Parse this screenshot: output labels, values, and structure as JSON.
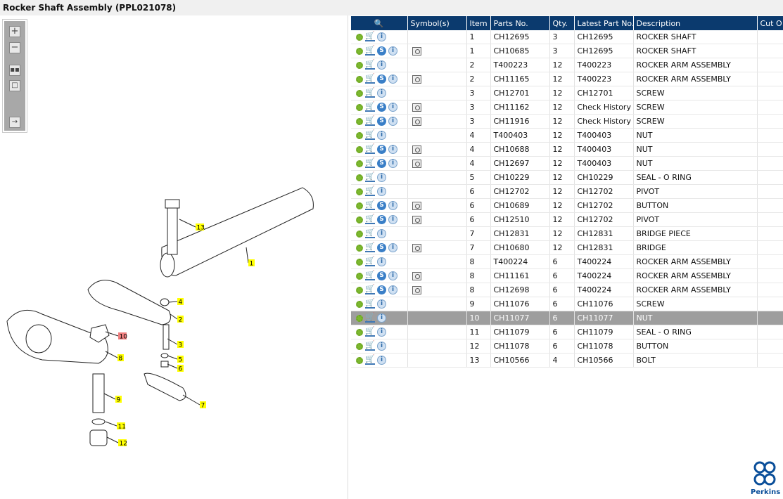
{
  "title": "Rocker Shaft Assembly (PPL021078)",
  "toolbar": [
    {
      "icon": "zoom-in-icon"
    },
    {
      "icon": "zoom-out-icon"
    },
    {
      "icon": "fit-all-icon"
    },
    {
      "icon": "actual-size-icon"
    },
    {
      "icon": "export-list-icon"
    }
  ],
  "diagram": {
    "callouts": [
      "13",
      "1",
      "4",
      "2",
      "10",
      "3",
      "8",
      "5",
      "6",
      "9",
      "7",
      "11",
      "12"
    ],
    "highlighted": "10",
    "highlight_color": "#f08080",
    "callout_color": "#ffff00"
  },
  "table": {
    "header_icon": "search-catalog-icon",
    "columns": [
      "",
      "Symbol(s)",
      "Item",
      "Parts No.",
      "Qty.",
      "Latest Part No.",
      "Description",
      "Cut O"
    ],
    "header_color": "#0b3a6e",
    "selected_color": "#9e9e9e",
    "rows": [
      {
        "item": "1",
        "part": "CH12695",
        "qty": "3",
        "latest": "CH12695",
        "desc": "ROCKER SHAFT",
        "s": false,
        "sym": false
      },
      {
        "item": "1",
        "part": "CH10685",
        "qty": "3",
        "latest": "CH12695",
        "desc": "ROCKER SHAFT",
        "s": true,
        "sym": true
      },
      {
        "item": "2",
        "part": "T400223",
        "qty": "12",
        "latest": "T400223",
        "desc": "ROCKER ARM ASSEMBLY",
        "s": false,
        "sym": false
      },
      {
        "item": "2",
        "part": "CH11165",
        "qty": "12",
        "latest": "T400223",
        "desc": "ROCKER ARM ASSEMBLY",
        "s": true,
        "sym": true
      },
      {
        "item": "3",
        "part": "CH12701",
        "qty": "12",
        "latest": "CH12701",
        "desc": "SCREW",
        "s": false,
        "sym": false
      },
      {
        "item": "3",
        "part": "CH11162",
        "qty": "12",
        "latest": "Check History",
        "desc": "SCREW",
        "s": true,
        "sym": true
      },
      {
        "item": "3",
        "part": "CH11916",
        "qty": "12",
        "latest": "Check History",
        "desc": "SCREW",
        "s": true,
        "sym": true
      },
      {
        "item": "4",
        "part": "T400403",
        "qty": "12",
        "latest": "T400403",
        "desc": "NUT",
        "s": false,
        "sym": false
      },
      {
        "item": "4",
        "part": "CH10688",
        "qty": "12",
        "latest": "T400403",
        "desc": "NUT",
        "s": true,
        "sym": true
      },
      {
        "item": "4",
        "part": "CH12697",
        "qty": "12",
        "latest": "T400403",
        "desc": "NUT",
        "s": true,
        "sym": true
      },
      {
        "item": "5",
        "part": "CH10229",
        "qty": "12",
        "latest": "CH10229",
        "desc": "SEAL - O RING",
        "s": false,
        "sym": false
      },
      {
        "item": "6",
        "part": "CH12702",
        "qty": "12",
        "latest": "CH12702",
        "desc": "PIVOT",
        "s": false,
        "sym": false
      },
      {
        "item": "6",
        "part": "CH10689",
        "qty": "12",
        "latest": "CH12702",
        "desc": "BUTTON",
        "s": true,
        "sym": true
      },
      {
        "item": "6",
        "part": "CH12510",
        "qty": "12",
        "latest": "CH12702",
        "desc": "PIVOT",
        "s": true,
        "sym": true
      },
      {
        "item": "7",
        "part": "CH12831",
        "qty": "12",
        "latest": "CH12831",
        "desc": "BRIDGE PIECE",
        "s": false,
        "sym": false
      },
      {
        "item": "7",
        "part": "CH10680",
        "qty": "12",
        "latest": "CH12831",
        "desc": "BRIDGE",
        "s": true,
        "sym": true
      },
      {
        "item": "8",
        "part": "T400224",
        "qty": "6",
        "latest": "T400224",
        "desc": "ROCKER ARM ASSEMBLY",
        "s": false,
        "sym": false
      },
      {
        "item": "8",
        "part": "CH11161",
        "qty": "6",
        "latest": "T400224",
        "desc": "ROCKER ARM ASSEMBLY",
        "s": true,
        "sym": true
      },
      {
        "item": "8",
        "part": "CH12698",
        "qty": "6",
        "latest": "T400224",
        "desc": "ROCKER ARM ASSEMBLY",
        "s": true,
        "sym": true
      },
      {
        "item": "9",
        "part": "CH11076",
        "qty": "6",
        "latest": "CH11076",
        "desc": "SCREW",
        "s": false,
        "sym": false
      },
      {
        "item": "10",
        "part": "CH11077",
        "qty": "6",
        "latest": "CH11077",
        "desc": "NUT",
        "s": false,
        "sym": false,
        "selected": true
      },
      {
        "item": "11",
        "part": "CH11079",
        "qty": "6",
        "latest": "CH11079",
        "desc": "SEAL - O RING",
        "s": false,
        "sym": false
      },
      {
        "item": "12",
        "part": "CH11078",
        "qty": "6",
        "latest": "CH11078",
        "desc": "BUTTON",
        "s": false,
        "sym": false
      },
      {
        "item": "13",
        "part": "CH10566",
        "qty": "4",
        "latest": "CH10566",
        "desc": "BOLT",
        "s": false,
        "sym": false
      }
    ]
  },
  "logo": {
    "text": "Perkins",
    "color": "#0b4f9a"
  }
}
